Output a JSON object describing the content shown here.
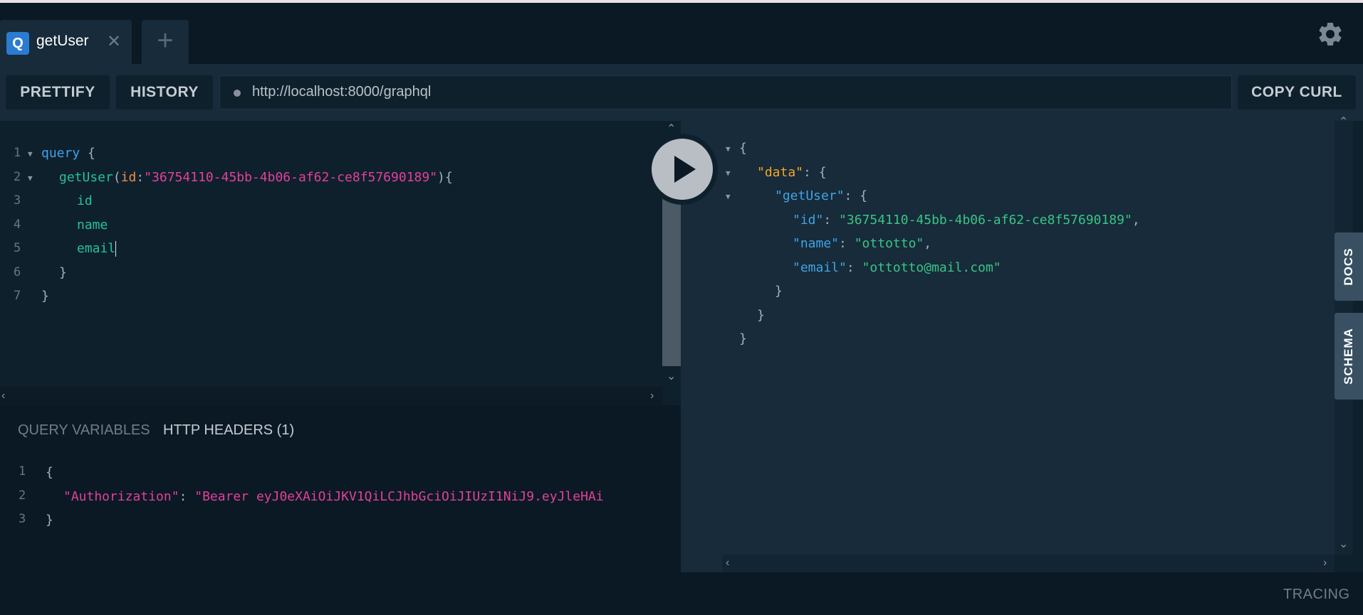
{
  "tabs": [
    {
      "badge": "Q",
      "title": "getUser",
      "close": "✕"
    }
  ],
  "tab_add": "+",
  "toolbar": {
    "prettify": "PRETTIFY",
    "history": "HISTORY",
    "url": "http://localhost:8000/graphql",
    "copy_curl": "COPY CURL"
  },
  "editor": {
    "line_numbers": [
      "1",
      "2",
      "3",
      "4",
      "5",
      "6",
      "7"
    ],
    "query_keyword": "query",
    "open_brace": " {",
    "field_name": "getUser",
    "paren_open": "(",
    "arg_name": "id",
    "colon": ":",
    "arg_value": "\"36754110-45bb-4b06-af62-ce8f57690189\"",
    "paren_close": "){",
    "fields": [
      "id",
      "name",
      "email"
    ],
    "inner_close": "}",
    "outer_close": "}"
  },
  "variables_panel": {
    "tab_query_variables": "QUERY VARIABLES",
    "tab_http_headers": "HTTP HEADERS (1)",
    "line_numbers": [
      "1",
      "2",
      "3"
    ],
    "open": "{",
    "header_key": "\"Authorization\"",
    "header_sep": ": ",
    "header_value": "\"Bearer eyJ0eXAiOiJKV1QiLCJhbGciOiJIUzI1NiJ9.eyJleHAi",
    "close": "}"
  },
  "result": {
    "open": "{",
    "data_key": "\"data\"",
    "data_sep": ": {",
    "getuser_key": "\"getUser\"",
    "getuser_sep": ": {",
    "id_key": "\"id\"",
    "id_value": "\"36754110-45bb-4b06-af62-ce8f57690189\"",
    "name_key": "\"name\"",
    "name_value": "\"ottotto\"",
    "email_key": "\"email\"",
    "email_value": "\"ottotto@mail.com\"",
    "sep": ": ",
    "comma": ",",
    "close": "}"
  },
  "side_tabs": {
    "docs": "DOCS",
    "schema": "SCHEMA"
  },
  "footer": {
    "tracing": "TRACING"
  },
  "icons": {
    "settings": "gear-icon",
    "run": "play-icon"
  },
  "colors": {
    "accent": "#2b7bd0",
    "keyword": "#3fa3e6",
    "string": "#e1409c",
    "result_string": "#3ac486",
    "data_key": "#f5a623"
  }
}
